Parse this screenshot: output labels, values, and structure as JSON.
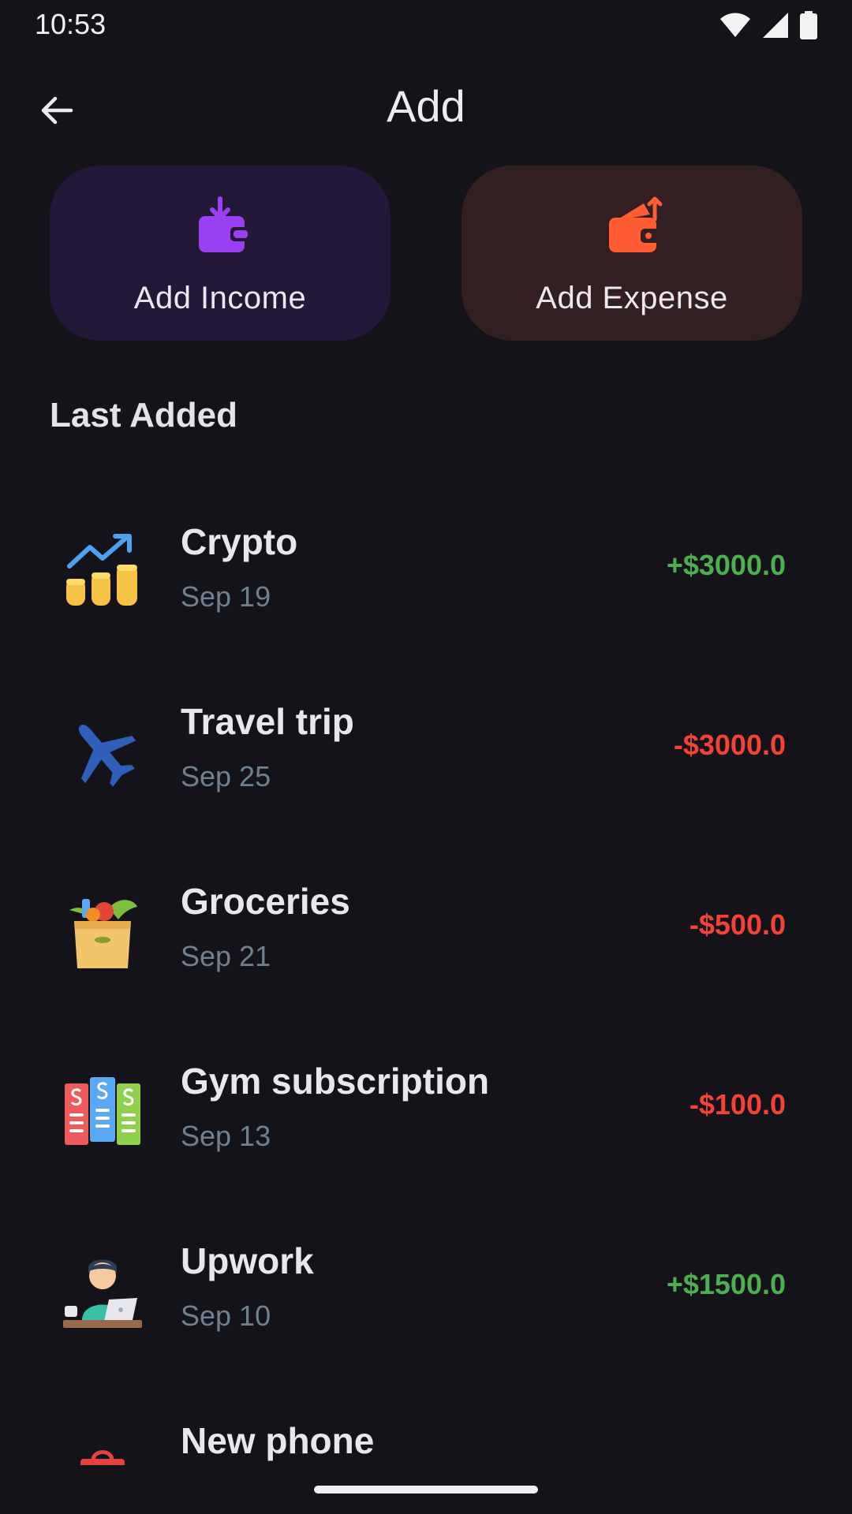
{
  "status_bar": {
    "time": "10:53",
    "icons": [
      "wifi-icon",
      "cellular-signal-icon",
      "battery-icon"
    ]
  },
  "app_bar": {
    "back_icon": "arrow-back-icon",
    "title": "Add"
  },
  "actions": {
    "income": {
      "label": "Add Income",
      "icon": "wallet-income-icon",
      "bg": "#231838",
      "accent": "#9b3ff2"
    },
    "expense": {
      "label": "Add Expense",
      "icon": "wallet-expense-icon",
      "bg": "#331f21",
      "accent": "#ff5c33"
    }
  },
  "last_added": {
    "title": "Last Added",
    "items": [
      {
        "title": "Crypto",
        "date": "Sep 19",
        "amount": "+$3000.0",
        "type": "income",
        "icon": "crypto-coins-icon"
      },
      {
        "title": "Travel trip",
        "date": "Sep 25",
        "amount": "-$3000.0",
        "type": "expense",
        "icon": "airplane-icon"
      },
      {
        "title": "Groceries",
        "date": "Sep 21",
        "amount": "-$500.0",
        "type": "expense",
        "icon": "grocery-bag-icon"
      },
      {
        "title": "Gym subscription",
        "date": "Sep 13",
        "amount": "-$100.0",
        "type": "expense",
        "icon": "subscription-bills-icon"
      },
      {
        "title": "Upwork",
        "date": "Sep 10",
        "amount": "+$1500.0",
        "type": "income",
        "icon": "freelancer-laptop-icon"
      },
      {
        "title": "New phone",
        "date": "",
        "amount": "",
        "type": "expense",
        "icon": "shopping-bag-icon"
      }
    ]
  },
  "colors": {
    "background": "#15131a",
    "income": "#4caf50",
    "expense": "#f44336",
    "date_text": "#6f8090"
  }
}
